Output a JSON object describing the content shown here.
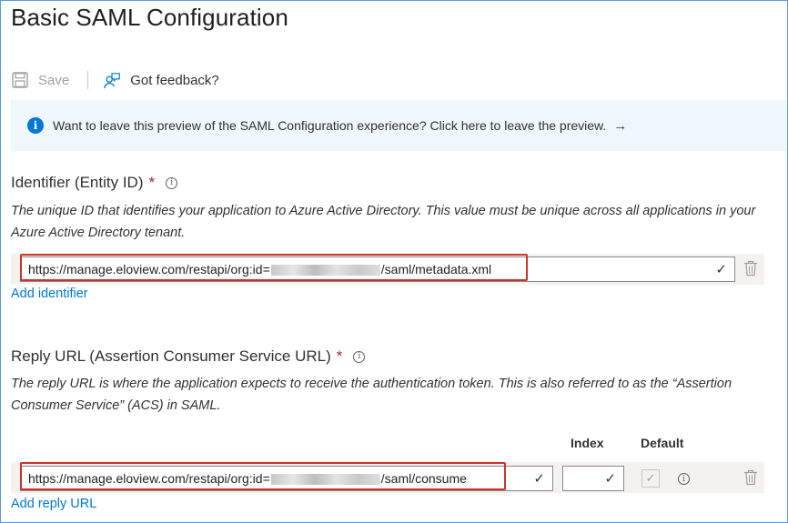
{
  "page": {
    "title": "Basic SAML Configuration"
  },
  "toolbar": {
    "save_label": "Save",
    "feedback_label": "Got feedback?"
  },
  "banner": {
    "text": "Want to leave this preview of the SAML Configuration experience? Click here to leave the preview.",
    "arrow": "→"
  },
  "identifier": {
    "label": "Identifier (Entity ID)",
    "required_mark": "*",
    "description": "The unique ID that identifies your application to Azure Active Directory. This value must be unique across all applications in your Azure Active Directory tenant.",
    "value_prefix": "https://manage.eloview.com/restapi/org:id=",
    "value_suffix": "/saml/metadata.xml",
    "add_link": "Add identifier"
  },
  "reply": {
    "label": "Reply URL (Assertion Consumer Service URL)",
    "required_mark": "*",
    "description": "The reply URL is where the application expects to receive the authentication token. This is also referred to as the “Assertion Consumer Service” (ACS) in SAML.",
    "index_header": "Index",
    "default_header": "Default",
    "value_prefix": "https://manage.eloview.com/restapi/org:id=",
    "value_suffix": "/saml/consume",
    "index_value": "",
    "add_link": "Add reply URL"
  },
  "colors": {
    "accent": "#0078d4",
    "required": "#a4262c",
    "highlight": "#d0312d",
    "banner_bg": "#eff6fc"
  },
  "icons": [
    "save-icon",
    "feedback-icon",
    "info-icon",
    "help-icon",
    "check-icon",
    "trash-icon"
  ]
}
